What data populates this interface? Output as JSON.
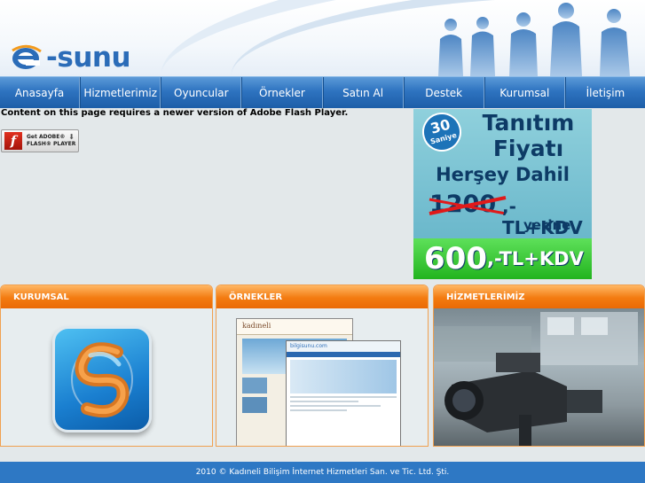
{
  "brand": {
    "logo_text": "-sunu",
    "accent": "#2b6cb8"
  },
  "nav": {
    "items": [
      {
        "label": "Anasayfa"
      },
      {
        "label": "Hizmetlerimiz"
      },
      {
        "label": "Oyuncular"
      },
      {
        "label": "Örnekler"
      },
      {
        "label": "Satın Al"
      },
      {
        "label": "Destek"
      },
      {
        "label": "Kurumsal"
      },
      {
        "label": "İletişim"
      }
    ]
  },
  "flash": {
    "message": "Content on this page requires a newer version of Adobe Flash Player.",
    "button_line1": "Get ADOBE®",
    "button_line2": "FLASH® PLAYER"
  },
  "banner": {
    "badge_number": "30",
    "badge_text": "Saniye",
    "title_line1": "Tanıtım",
    "title_line2": "Fiyatı",
    "subtitle": "Herşey Dahil",
    "old_price": "1200",
    "old_price_unit": ",-TL+KDV",
    "instead": "yerine",
    "new_price": "600",
    "new_price_unit": ",-TL+KDV"
  },
  "panels": [
    {
      "title": "KURUMSAL"
    },
    {
      "title": "ÖRNEKLER"
    },
    {
      "title": "HİZMETLERİMİZ"
    }
  ],
  "samples": {
    "site1": "kadıneli",
    "site2": "bilgisunu.com"
  },
  "footer": {
    "text": "2010 © Kadıneli Bilişim İnternet Hizmetleri San. ve Tic. Ltd. Şti."
  }
}
